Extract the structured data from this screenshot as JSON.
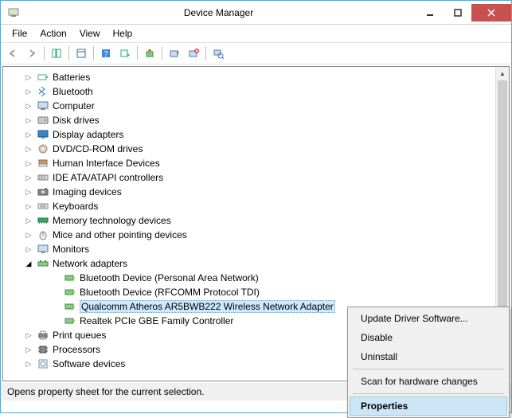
{
  "window": {
    "title": "Device Manager"
  },
  "menu": {
    "items": [
      "File",
      "Action",
      "View",
      "Help"
    ]
  },
  "tree": {
    "categories": [
      {
        "label": "Batteries",
        "expanded": false
      },
      {
        "label": "Bluetooth",
        "expanded": false
      },
      {
        "label": "Computer",
        "expanded": false
      },
      {
        "label": "Disk drives",
        "expanded": false
      },
      {
        "label": "Display adapters",
        "expanded": false
      },
      {
        "label": "DVD/CD-ROM drives",
        "expanded": false
      },
      {
        "label": "Human Interface Devices",
        "expanded": false
      },
      {
        "label": "IDE ATA/ATAPI controllers",
        "expanded": false
      },
      {
        "label": "Imaging devices",
        "expanded": false
      },
      {
        "label": "Keyboards",
        "expanded": false
      },
      {
        "label": "Memory technology devices",
        "expanded": false
      },
      {
        "label": "Mice and other pointing devices",
        "expanded": false
      },
      {
        "label": "Monitors",
        "expanded": false
      },
      {
        "label": "Network adapters",
        "expanded": true,
        "children": [
          {
            "label": "Bluetooth Device (Personal Area Network)"
          },
          {
            "label": "Bluetooth Device (RFCOMM Protocol TDI)"
          },
          {
            "label": "Qualcomm Atheros AR5BWB222 Wireless Network Adapter",
            "selected": true
          },
          {
            "label": "Realtek PCIe GBE Family Controller"
          }
        ]
      },
      {
        "label": "Print queues",
        "expanded": false
      },
      {
        "label": "Processors",
        "expanded": false
      },
      {
        "label": "Software devices",
        "expanded": false
      }
    ]
  },
  "context_menu": {
    "items": [
      {
        "label": "Update Driver Software..."
      },
      {
        "label": "Disable"
      },
      {
        "label": "Uninstall"
      },
      {
        "sep": true
      },
      {
        "label": "Scan for hardware changes"
      },
      {
        "sep": true
      },
      {
        "label": "Properties",
        "highlighted": true
      }
    ]
  },
  "status": {
    "text": "Opens property sheet for the current selection."
  }
}
